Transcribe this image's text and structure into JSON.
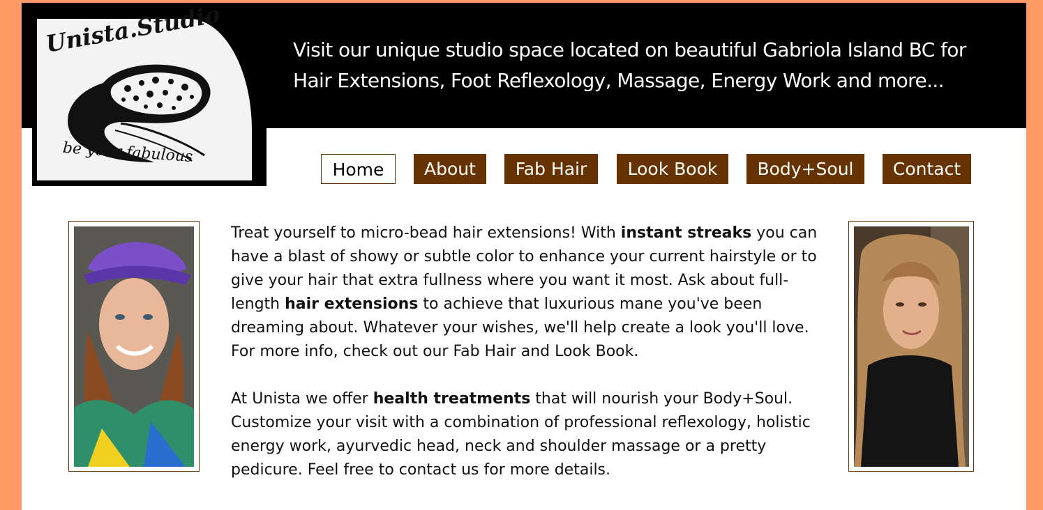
{
  "colors": {
    "page_background": "#ff9966",
    "header_background": "#000000",
    "nav_background": "#663300",
    "nav_text": "#ffffff",
    "content_background": "#ffffff"
  },
  "logo": {
    "title": "Unista.Studio",
    "slogan": "be your fabulous"
  },
  "header": {
    "tagline": "Visit our unique studio space located on beautiful Gabriola Island BC for Hair Extensions, Foot Reflexology, Massage, Energy Work and more..."
  },
  "nav": {
    "items": [
      {
        "label": "Home",
        "active": true
      },
      {
        "label": "About",
        "active": false
      },
      {
        "label": "Fab Hair",
        "active": false
      },
      {
        "label": "Look Book",
        "active": false
      },
      {
        "label": "Body+Soul",
        "active": false
      },
      {
        "label": "Contact",
        "active": false
      }
    ]
  },
  "content": {
    "paragraph1": {
      "t1": "Treat yourself to micro-bead hair extensions! With ",
      "b1": "instant streaks",
      "t2": " you can have a blast of showy or subtle color to enhance your current hairstyle or to give your hair that extra fullness where you want it most. Ask about full-length ",
      "b2": "hair extensions",
      "t3": " to achieve that luxurious mane you've been dreaming about. Whatever your wishes, we'll help create a look you'll love. For more info, check out our Fab Hair and Look Book."
    },
    "paragraph2": {
      "t1": "At Unista we offer ",
      "b1": "health treatments",
      "t2": " that will nourish your Body+Soul. Customize your visit with a combination of professional reflexology, holistic energy work, ayurvedic head, neck and shoulder massage or a pretty pedicure. Feel free to contact us for more details."
    }
  },
  "photos": {
    "left": {
      "icon": "portrait-photo"
    },
    "right": {
      "icon": "portrait-photo"
    }
  }
}
